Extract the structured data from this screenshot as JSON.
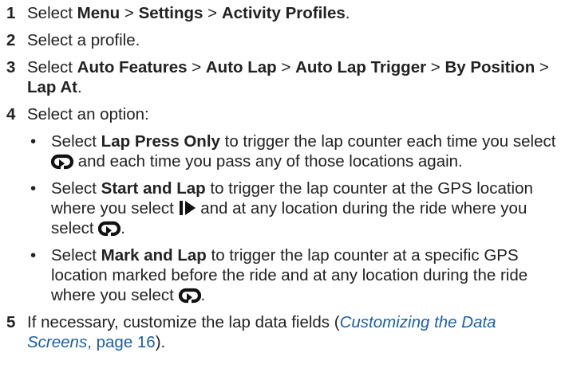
{
  "steps": [
    {
      "num": "1",
      "p1": "Select ",
      "b1": "Menu",
      "p2": " > ",
      "b2": "Settings",
      "p3": " > ",
      "b3": "Activity Profiles",
      "p4": "."
    },
    {
      "num": "2",
      "text": "Select a profile."
    },
    {
      "num": "3",
      "p1": "Select ",
      "b1": "Auto Features",
      "p2": " > ",
      "b2": "Auto Lap",
      "p3": " > ",
      "b3": "Auto Lap Trigger",
      "p4": " > ",
      "b4": "By Position",
      "p5": " > ",
      "b5": "Lap At",
      "p6": "."
    },
    {
      "num": "4",
      "text": "Select an option:",
      "options": [
        {
          "bullet": "•",
          "p1": "Select ",
          "b1": "Lap Press Only",
          "p2": " to trigger the lap counter each time you select ",
          "icon": "lap-icon",
          "p3": " and each time you pass any of those locations again."
        },
        {
          "bullet": "•",
          "p1": "Select ",
          "b1": "Start and Lap",
          "p2": " to trigger the lap counter at the GPS location where you select ",
          "icon": "start-stop-icon",
          "p3": " and at any location during the ride where you select ",
          "icon2": "lap-icon",
          "p4": "."
        },
        {
          "bullet": "•",
          "p1": "Select ",
          "b1": "Mark and Lap",
          "p2": " to trigger the lap counter at a specific GPS location marked before the ride and at any location during the ride where you select ",
          "icon": "lap-icon",
          "p3": "."
        }
      ]
    },
    {
      "num": "5",
      "p1": "If necessary, customize the lap data fields (",
      "link": "Customizing the Data Screens",
      "p2": ", page 16",
      "p3": ")."
    }
  ],
  "colors": {
    "text": "#222222",
    "link": "#1a5fa8"
  }
}
